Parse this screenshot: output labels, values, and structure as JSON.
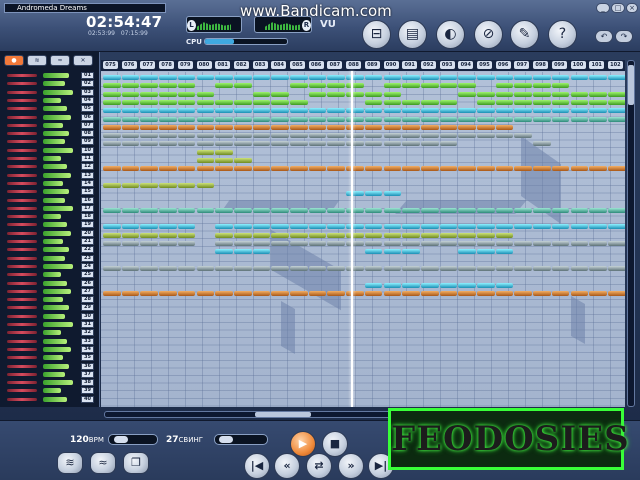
{
  "app": {
    "song_title": "Andromeda Dreams",
    "clock": "02:54:47",
    "clock_sub": "02:53:99   07:15:99",
    "vu_label": "VU",
    "vu_left_tag": "L",
    "vu_right_tag": "R",
    "cpu_label": "CPU",
    "cpu_level": 0.35,
    "watermark": "www.Bandicam.com"
  },
  "toolbar": {
    "buttons": [
      {
        "icon": "open-folder-icon",
        "glyph": "⊟"
      },
      {
        "icon": "folder-icon",
        "glyph": "▤"
      },
      {
        "icon": "record-disc-icon",
        "glyph": "◐"
      },
      {
        "icon": "mute-icon",
        "glyph": "⊘"
      },
      {
        "icon": "tools-icon",
        "glyph": "✎"
      },
      {
        "icon": "help-icon",
        "glyph": "?"
      }
    ],
    "window_buttons": [
      "_",
      "□",
      "×"
    ],
    "small_buttons": [
      "↶",
      "↷"
    ]
  },
  "track_panel": {
    "style_tabs": [
      "●",
      "≋",
      "≈",
      "✕"
    ],
    "tracks": [
      "01",
      "02",
      "03",
      "04",
      "05",
      "06",
      "07",
      "08",
      "09",
      "10",
      "11",
      "12",
      "13",
      "14",
      "15",
      "16",
      "17",
      "18",
      "19",
      "20",
      "21",
      "22",
      "23",
      "24",
      "25",
      "26",
      "27",
      "28",
      "29",
      "30",
      "31",
      "32",
      "33",
      "34",
      "35",
      "36",
      "37",
      "38",
      "39",
      "40"
    ]
  },
  "grid": {
    "bars": [
      "075",
      "076",
      "077",
      "078",
      "079",
      "080",
      "081",
      "082",
      "083",
      "084",
      "085",
      "086",
      "087",
      "088",
      "089",
      "090",
      "091",
      "092",
      "093",
      "094",
      "095",
      "096",
      "097",
      "098",
      "099",
      "100",
      "101",
      "102"
    ]
  },
  "bottom": {
    "tempo_value": "120",
    "tempo_unit": "BPM",
    "swing_value": "27",
    "swing_unit": "СВИНГ",
    "tempo_level": 0.1,
    "swing_level": 0.05
  },
  "stamp": "FEODOSIES",
  "colors": {
    "green": "#5fd63a",
    "cyan": "#3ec9e8",
    "orange": "#d9813a",
    "gray": "#8ea2aa",
    "olive": "#9cbc3a",
    "stamp_border": "#39ff39"
  }
}
